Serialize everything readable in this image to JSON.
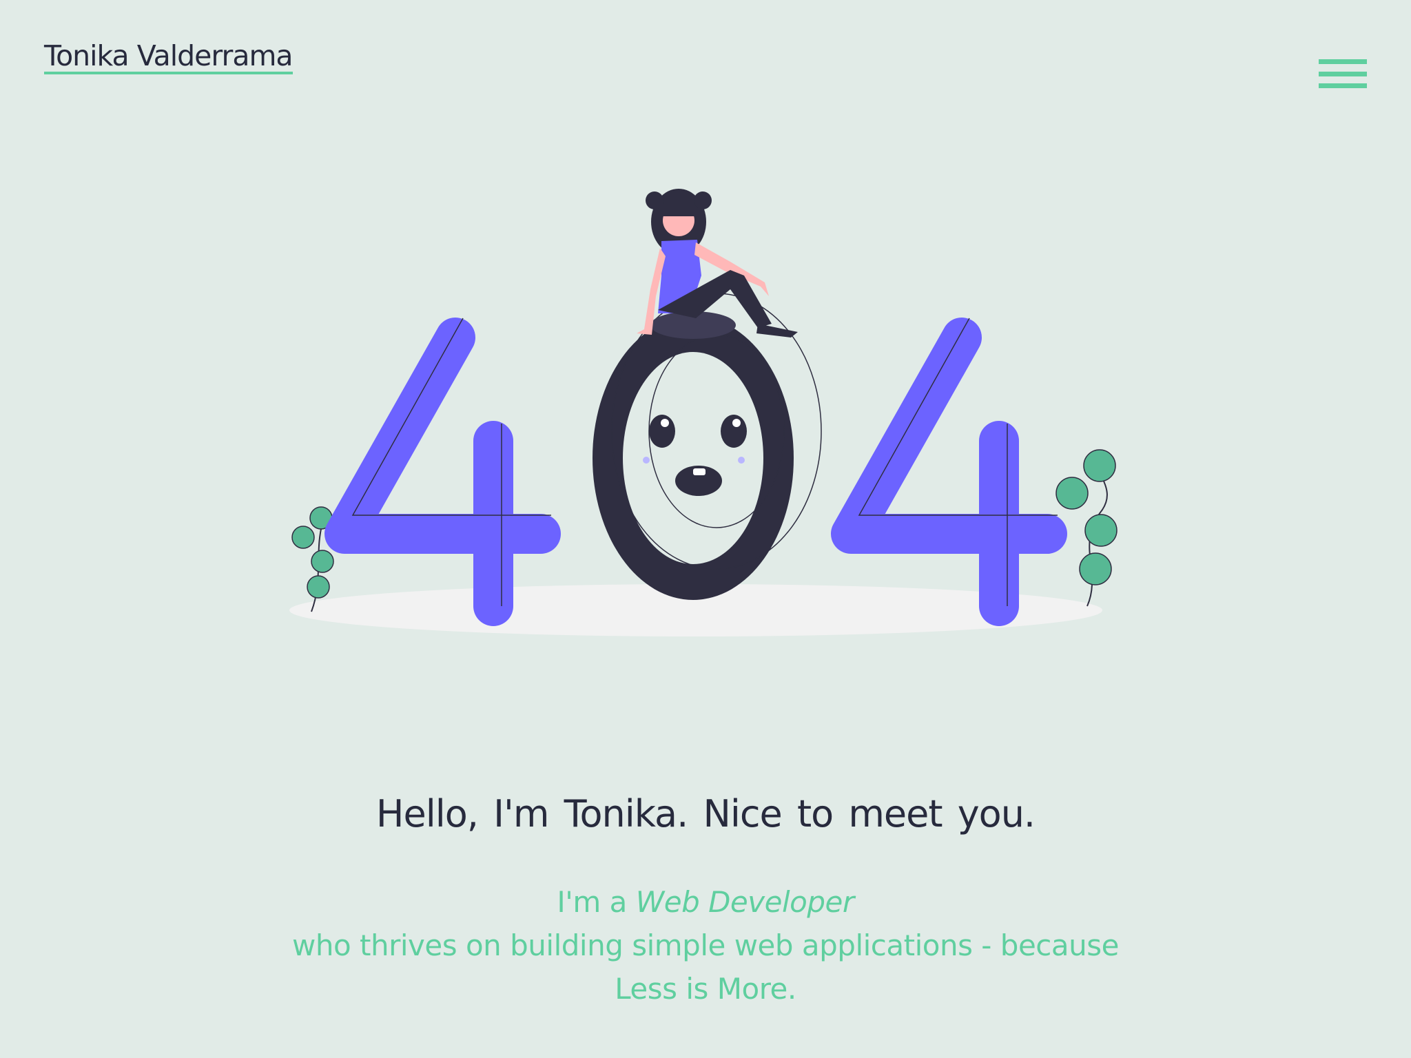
{
  "header": {
    "brand_name": "Tonika Valderrama",
    "menu_icon": "hamburger-menu-icon"
  },
  "illustration": {
    "digits": [
      "4",
      "0",
      "4"
    ],
    "icons": [
      "woman-sitting-icon",
      "plant-icon"
    ]
  },
  "hero": {
    "greeting": "Hello,  I'm Tonika.  Nice to meet you.",
    "intro_prefix": "I'm a ",
    "role": "Web Developer",
    "line2": "who thrives on building simple web applications - because",
    "line3": "Less is  More."
  },
  "colors": {
    "background": "#e1ebe7",
    "accent": "#5fcf9f",
    "text_dark": "#272a3d",
    "purple": "#6c63ff",
    "navy": "#2f2e41",
    "leaf": "#57b894"
  }
}
